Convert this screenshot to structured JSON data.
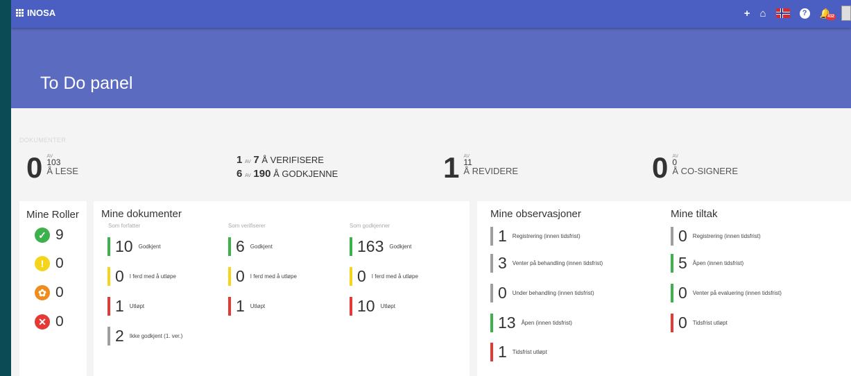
{
  "topbar": {
    "brand": "INOSA",
    "add_icon": "+",
    "home_icon": "⌂",
    "help_icon": "?",
    "bell_icon": "🔔",
    "notif_count": "432"
  },
  "hero": {
    "title": "To Do panel"
  },
  "dokumenter": {
    "label": "DOKUMENTER",
    "lese": {
      "count": "0",
      "av": "AV",
      "total": "103",
      "label": "Å LESE"
    },
    "verifisere": {
      "count": "1",
      "av": "AV",
      "total": "7",
      "label": "Å VERIFISERE"
    },
    "godkjenne": {
      "count": "6",
      "av": "AV",
      "total": "190",
      "label": "Å GODKJENNE"
    },
    "revidere": {
      "count": "1",
      "av": "AV",
      "total": "11",
      "label": "Å REVIDERE"
    },
    "cosignere": {
      "count": "0",
      "av": "AV",
      "total": "0",
      "label": "Å CO-SIGNERE"
    }
  },
  "roller": {
    "title": "Mine Roller",
    "items": [
      {
        "icon": "✓",
        "value": "9",
        "color": "#3db14b"
      },
      {
        "icon": "!",
        "value": "0",
        "color": "#f5d51b"
      },
      {
        "icon": "✿",
        "value": "0",
        "color": "#f08c1e"
      },
      {
        "icon": "✕",
        "value": "0",
        "color": "#e53935"
      }
    ]
  },
  "dokumenter_card": {
    "title": "Mine dokumenter",
    "columns": [
      {
        "heading": "Som forfatter",
        "items": [
          {
            "value": "10",
            "label": "Godkjent",
            "color": "#3db14b"
          },
          {
            "value": "0",
            "label": "I ferd med å utløpe",
            "color": "#f5d51b"
          },
          {
            "value": "1",
            "label": "Utløpt",
            "color": "#e53935"
          },
          {
            "value": "2",
            "label": "Ikke godkjent (1. ver.)",
            "color": "#9e9e9e"
          }
        ]
      },
      {
        "heading": "Som verifiserer",
        "items": [
          {
            "value": "6",
            "label": "Godkjent",
            "color": "#3db14b"
          },
          {
            "value": "0",
            "label": "I ferd med å utløpe",
            "color": "#f5d51b"
          },
          {
            "value": "1",
            "label": "Utløpt",
            "color": "#e53935"
          }
        ]
      },
      {
        "heading": "Som godkjenner",
        "items": [
          {
            "value": "163",
            "label": "Godkjent",
            "color": "#3db14b"
          },
          {
            "value": "0",
            "label": "I ferd med å utløpe",
            "color": "#f5d51b"
          },
          {
            "value": "10",
            "label": "Utløpt",
            "color": "#e53935"
          }
        ]
      }
    ]
  },
  "observasjoner": {
    "title": "Mine observasjoner",
    "items": [
      {
        "value": "1",
        "label": "Registrering (innen tidsfrist)",
        "color": "#9e9e9e"
      },
      {
        "value": "3",
        "label": "Venter på behandling (innen tidsfrist)",
        "color": "#9e9e9e"
      },
      {
        "value": "0",
        "label": "Under behandling (innen tidsfrist)",
        "color": "#9e9e9e"
      },
      {
        "value": "13",
        "label": "Åpen (innen tidsfrist)",
        "color": "#3db14b"
      },
      {
        "value": "1",
        "label": "Tidsfrist utløpt",
        "color": "#e53935"
      }
    ]
  },
  "tiltak": {
    "title": "Mine tiltak",
    "items": [
      {
        "value": "0",
        "label": "Registrering (innen tidsfrist)",
        "color": "#9e9e9e"
      },
      {
        "value": "5",
        "label": "Åpen (innen tidsfrist)",
        "color": "#3db14b"
      },
      {
        "value": "0",
        "label": "Venter på evaluering (innen tidsfrist)",
        "color": "#3db14b"
      },
      {
        "value": "0",
        "label": "Tidsfrist utløpt",
        "color": "#e53935"
      }
    ]
  }
}
